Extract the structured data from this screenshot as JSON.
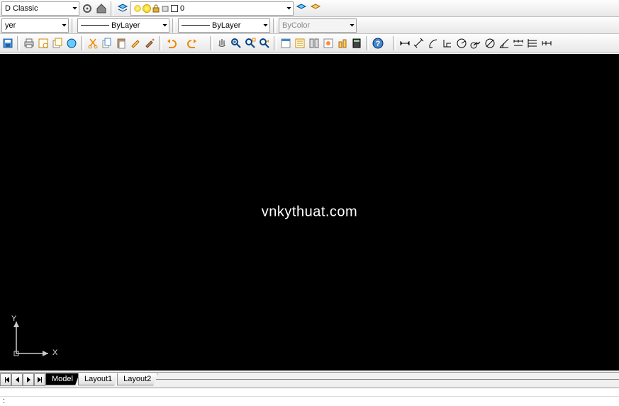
{
  "topbar": {
    "workspace": "D Classic",
    "layerCombo": "0"
  },
  "propbar": {
    "layerDD": "yer",
    "lineType": "ByLayer",
    "lineWeight": "ByLayer",
    "plotStyle": "ByColor"
  },
  "watermark": "vnkythuat.com",
  "ucs": {
    "y": "Y",
    "x": "X"
  },
  "tabs": {
    "model": "Model",
    "l1": "Layout1",
    "l2": "Layout2"
  },
  "cmdPrompt": ":"
}
